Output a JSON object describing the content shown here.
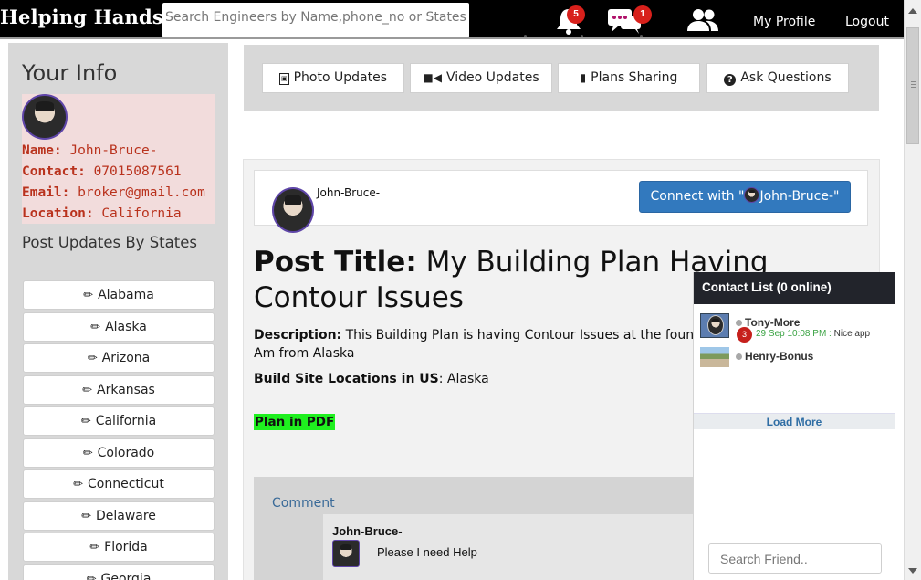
{
  "navbar": {
    "brand": "Helping Hands",
    "search_placeholder": "Search Engineers by Name,phone_no or States",
    "notifications_count": "5",
    "messages_count": "1",
    "profile_label": "My Profile",
    "logout_label": "Logout"
  },
  "sidebar": {
    "heading": "Your Info",
    "info": {
      "name_label": "Name:",
      "name_value": "John-Bruce-",
      "contact_label": "Contact:",
      "contact_value": "07015087561",
      "email_label": "Email:",
      "email_value": "broker@gmail.com",
      "location_label": "Location:",
      "location_value": "California"
    },
    "states_heading": "Post Updates By States",
    "states": [
      "Alabama",
      "Alaska",
      "Arizona",
      "Arkansas",
      "California",
      "Colorado",
      "Connecticut",
      "Delaware",
      "Florida",
      "Georgia"
    ]
  },
  "tabs": [
    {
      "label": "Photo Updates",
      "icon": "photo-icon"
    },
    {
      "label": "Video Updates",
      "icon": "video-camera-icon"
    },
    {
      "label": "Plans Sharing",
      "icon": "file-icon"
    },
    {
      "label": "Ask Questions",
      "icon": "question-circle-icon"
    }
  ],
  "post": {
    "author": "John-Bruce-",
    "connect_prefix": "Connect with \"",
    "connect_name": "John-Bruce-\"",
    "title_label": "Post Title:",
    "title_text": " My Building Plan Having Contour Issues",
    "description_label": "Description:",
    "description_text": " This Building Plan is having Contour Issues at the foundat help me resolve it . Am from Alaska",
    "site_label": "Build Site Locations in US",
    "site_value": ": Alaska",
    "pdf_label": "Plan in PDF"
  },
  "comments": {
    "label": "Comment",
    "items": [
      {
        "author": "John-Bruce-",
        "text": "Please I need Help"
      }
    ]
  },
  "contacts": {
    "header": "Contact List (0 online)",
    "items": [
      {
        "name": "Tony-More",
        "badge": "3",
        "time": "29 Sep 10:08 PM :",
        "message": " Nice app"
      },
      {
        "name": "Henry-Bonus",
        "badge": "",
        "time": "",
        "message": ""
      }
    ],
    "load_more": "Load More",
    "search_placeholder": "Search Friend.."
  },
  "colors": {
    "navbar_bg": "#000000",
    "badge": "#d8201b",
    "connect_button": "#3279be",
    "info_text": "#b9321d",
    "pdf_highlight": "#1ff01f",
    "contact_header": "#22242b"
  }
}
